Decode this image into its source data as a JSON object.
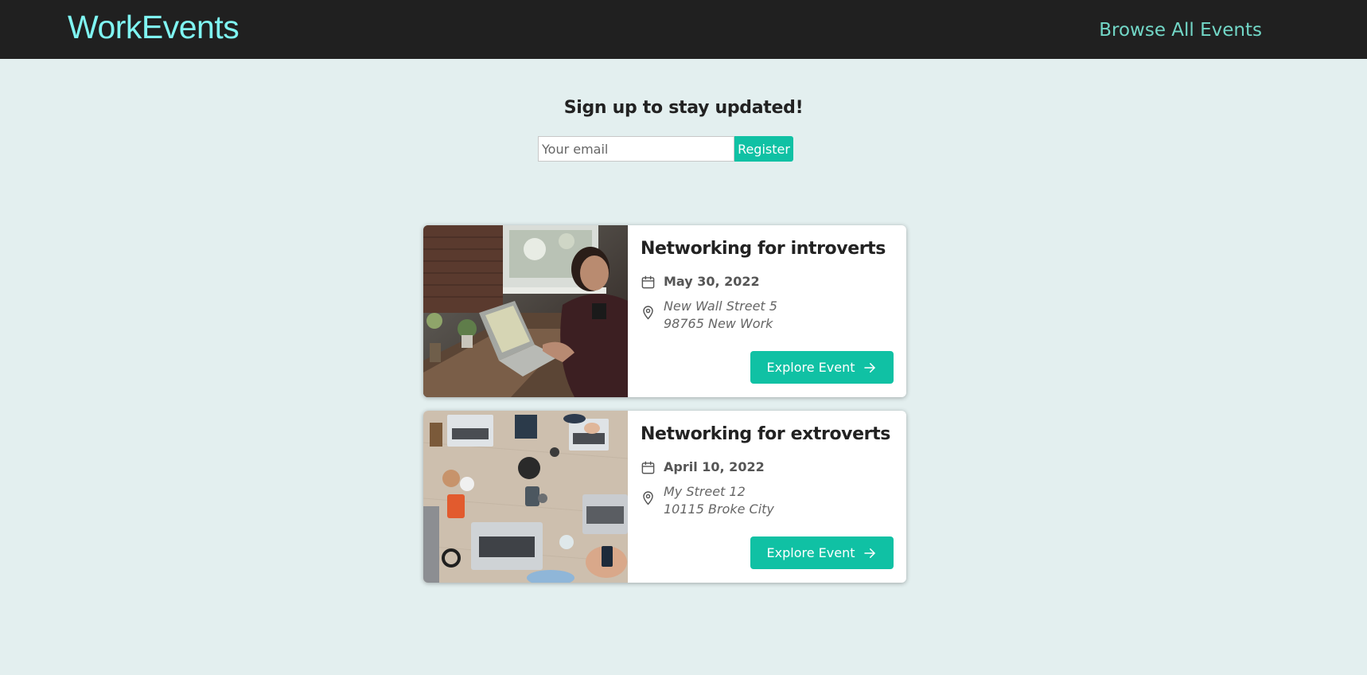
{
  "header": {
    "logo": "WorkEvents",
    "nav_link": "Browse All Events"
  },
  "signup": {
    "title": "Sign up to stay updated!",
    "email_placeholder": "Your email",
    "register_label": "Register"
  },
  "events": [
    {
      "title": "Networking for introverts",
      "date": "May 30, 2022",
      "address_line1": "New Wall Street 5",
      "address_line2": "98765 New Work",
      "button_label": "Explore Event",
      "image": "person-working-on-laptop-photo"
    },
    {
      "title": "Networking for extroverts",
      "date": "April 10, 2022",
      "address_line1": "My Street 12",
      "address_line2": "10115 Broke City",
      "button_label": "Explore Event",
      "image": "team-laptops-on-table-photo"
    }
  ],
  "colors": {
    "header_bg": "#202020",
    "logo": "#7ff5f2",
    "nav_link": "#72d7c7",
    "page_bg": "#e3efef",
    "accent": "#10c1a4"
  },
  "icons": {
    "date": "calendar-icon",
    "address": "map-pin-icon",
    "button": "arrow-right-icon"
  }
}
